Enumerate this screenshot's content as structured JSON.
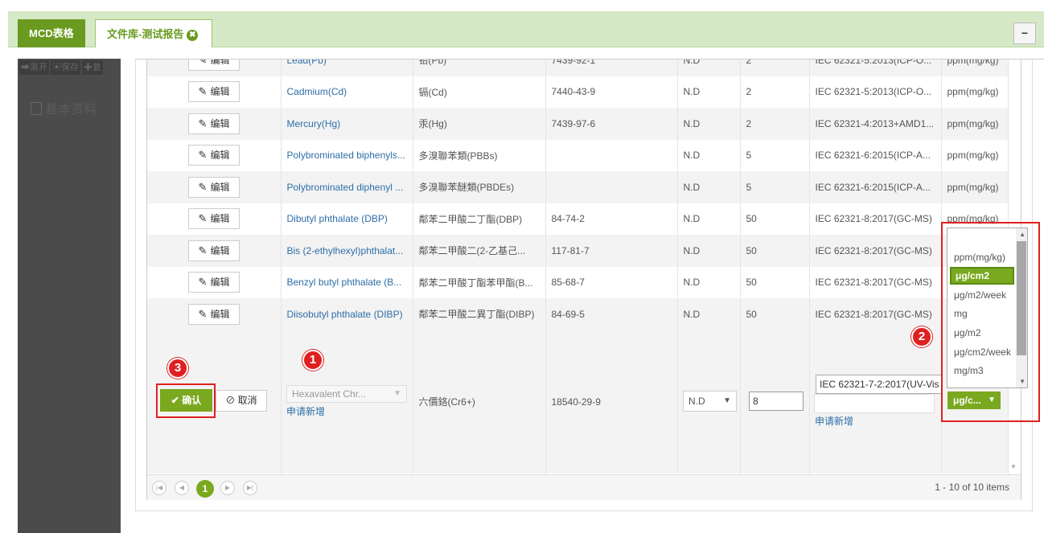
{
  "tabs": {
    "mcd": "MCD表格",
    "library": "文件库-测试报告",
    "close_glyph": "✖",
    "minimize": "−"
  },
  "background": {
    "tools": [
      "离开",
      "保存",
      "复"
    ],
    "section": "基本资料"
  },
  "rows": [
    {
      "edit": "编辑",
      "name": "Lead(Pb)",
      "cn": "铅(Pb)",
      "cas": "7439-92-1",
      "result": "N.D",
      "limit": "2",
      "method": "IEC 62321-5:2013(ICP-O...",
      "unit": "ppm(mg/kg)"
    },
    {
      "edit": "编辑",
      "name": "Cadmium(Cd)",
      "cn": "镉(Cd)",
      "cas": "7440-43-9",
      "result": "N.D",
      "limit": "2",
      "method": "IEC 62321-5:2013(ICP-O...",
      "unit": "ppm(mg/kg)"
    },
    {
      "edit": "编辑",
      "name": "Mercury(Hg)",
      "cn": "汞(Hg)",
      "cas": "7439-97-6",
      "result": "N.D",
      "limit": "2",
      "method": "IEC 62321-4:2013+AMD1...",
      "unit": "ppm(mg/kg)"
    },
    {
      "edit": "编辑",
      "name": "Polybrominated biphenyls...",
      "cn": "多溴聯苯類(PBBs)",
      "cas": "",
      "result": "N.D",
      "limit": "5",
      "method": "IEC 62321-6:2015(ICP-A...",
      "unit": "ppm(mg/kg)"
    },
    {
      "edit": "编辑",
      "name": "Polybrominated diphenyl ...",
      "cn": "多溴聯苯醚類(PBDEs)",
      "cas": "",
      "result": "N.D",
      "limit": "5",
      "method": "IEC 62321-6:2015(ICP-A...",
      "unit": "ppm(mg/kg)"
    },
    {
      "edit": "编辑",
      "name": "Dibutyl phthalate (DBP)",
      "cn": "鄰苯二甲酸二丁酯(DBP)",
      "cas": "84-74-2",
      "result": "N.D",
      "limit": "50",
      "method": "IEC 62321-8:2017(GC-MS)",
      "unit": "ppm(mg/kg)"
    },
    {
      "edit": "编辑",
      "name": "Bis (2-ethylhexyl)phthalat...",
      "cn": "鄰苯二甲酸二(2-乙基己...",
      "cas": "117-81-7",
      "result": "N.D",
      "limit": "50",
      "method": "IEC 62321-8:2017(GC-MS)",
      "unit": ""
    },
    {
      "edit": "编辑",
      "name": "Benzyl butyl phthalate (B...",
      "cn": "鄰苯二甲酸丁酯苯甲酯(B...",
      "cas": "85-68-7",
      "result": "N.D",
      "limit": "50",
      "method": "IEC 62321-8:2017(GC-MS)",
      "unit": ""
    },
    {
      "edit": "编辑",
      "name": "Diisobutyl phthalate (DIBP)",
      "cn": "鄰苯二甲酸二異丁酯(DIBP)",
      "cas": "84-69-5",
      "result": "N.D",
      "limit": "50",
      "method": "IEC 62321-8:2017(GC-MS)",
      "unit": ""
    }
  ],
  "editrow": {
    "confirm": "确认",
    "cancel": "取消",
    "substance_placeholder": "Hexavalent Chr...",
    "apply_new": "申请新增",
    "cn": "六價鉻(Cr6+)",
    "cas": "18540-29-9",
    "result": "N.D",
    "limit_value": "8",
    "method_value": "IEC 62321-7-2:2017(UV-Vis",
    "unit_value": "μg/c..."
  },
  "unit_options": [
    "ppm(mg/kg)",
    "μg/cm2",
    "μg/m2/week",
    "mg",
    "μg/m2",
    "μg/cm2/week",
    "mg/m3"
  ],
  "unit_selected": "μg/cm2",
  "badges": {
    "one": "1",
    "two": "2",
    "three": "3"
  },
  "pager": {
    "current": "1",
    "info": "1 - 10 of 10 items"
  }
}
